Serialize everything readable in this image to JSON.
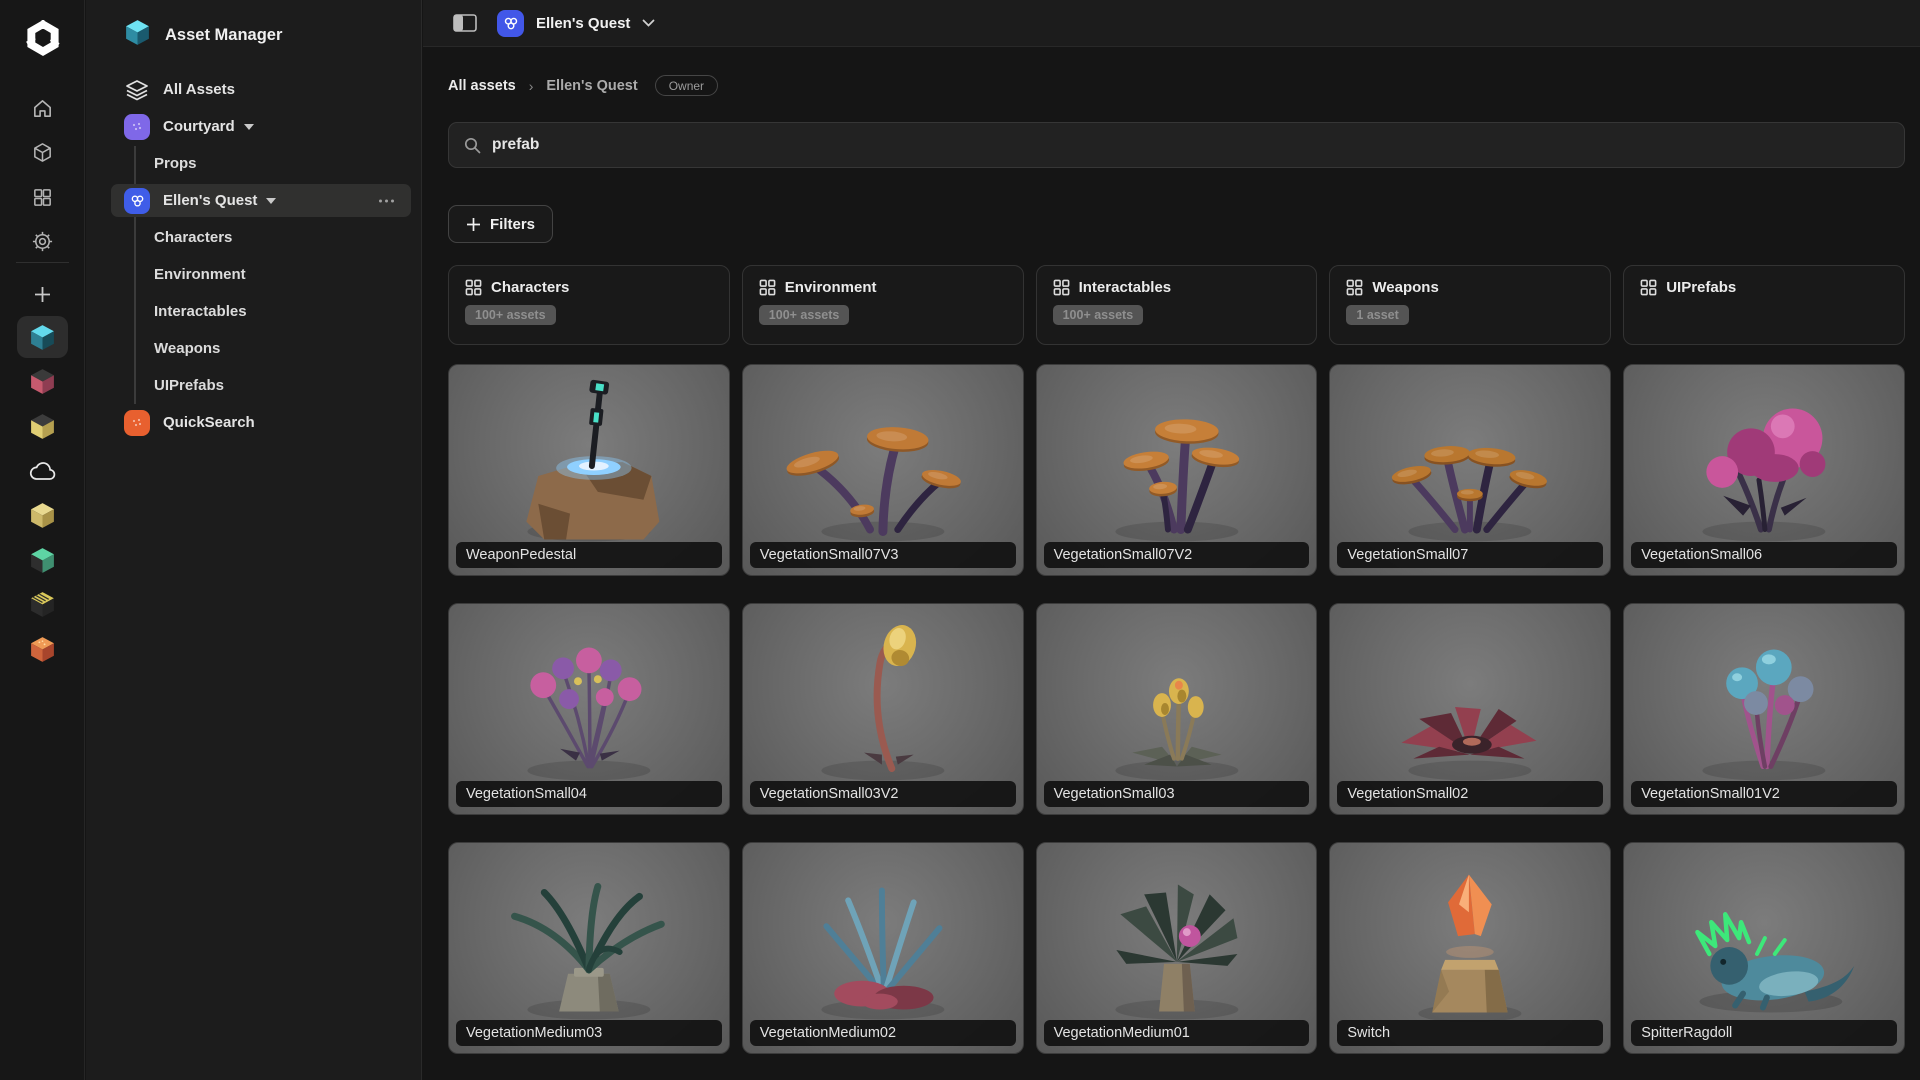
{
  "rail": {
    "logo": "unity-logo",
    "nav_icons": [
      {
        "name": "home-icon"
      },
      {
        "name": "box-icon"
      },
      {
        "name": "grid-icon"
      },
      {
        "name": "settings-gear-icon"
      }
    ],
    "projects": [
      {
        "name": "asset-manager-cube",
        "kind": "cube",
        "selected": true,
        "top": "#62d9ec",
        "left": "#2e7f93",
        "right": "#174b58"
      },
      {
        "name": "project-rose-cube",
        "kind": "cube",
        "top": "#3a3a3a",
        "left": "#c75a6e",
        "right": "#8f3d52"
      },
      {
        "name": "project-amber-cube",
        "kind": "cube",
        "top": "#3c3c3c",
        "left": "#e0ce74",
        "right": "#b5a050"
      },
      {
        "name": "cloud-icon",
        "kind": "cloud"
      },
      {
        "name": "project-cream-cube",
        "kind": "cube",
        "top": "#e8d98f",
        "left": "#cdb96a",
        "right": "#a89247"
      },
      {
        "name": "project-mint-cube",
        "kind": "cube",
        "top": "#5ed4a4",
        "left": "#2e2e2e",
        "right": "#3f8f70"
      },
      {
        "name": "project-striped-cube",
        "kind": "cube-striped",
        "top": "#d9c85a",
        "left": "#2c2c2c",
        "right": "#242424"
      },
      {
        "name": "project-ember-cube",
        "kind": "cube-dotted",
        "top": "#ef9a55",
        "left": "#d0653c",
        "right": "#a8452c"
      }
    ]
  },
  "sidebar": {
    "title": "Asset Manager",
    "title_icon_colors": {
      "top": "#6ee2f2",
      "left": "#2e8ca3",
      "right": "#1a5a6e"
    },
    "items": [
      {
        "label": "All Assets",
        "type": "root",
        "icon": "layers"
      },
      {
        "label": "Courtyard",
        "type": "root",
        "icon": "tile",
        "glyph": "dots",
        "color": "#7f68e8",
        "caret": true
      },
      {
        "label": "Props",
        "type": "sub"
      },
      {
        "label": "Ellen's Quest",
        "type": "root",
        "icon": "tile",
        "glyph": "circles",
        "color": "#3f5de8",
        "caret": true,
        "selected": true,
        "ellipsis": true
      },
      {
        "label": "Characters",
        "type": "sub"
      },
      {
        "label": "Environment",
        "type": "sub"
      },
      {
        "label": "Interactables",
        "type": "sub"
      },
      {
        "label": "Weapons",
        "type": "sub"
      },
      {
        "label": "UIPrefabs",
        "type": "sub"
      },
      {
        "label": "QuickSearch",
        "type": "root",
        "icon": "tile",
        "glyph": "dots",
        "color": "#e8602f"
      }
    ]
  },
  "topbar": {
    "project": "Ellen's Quest",
    "project_icon_color": "#4257e8"
  },
  "breadcrumb": {
    "root": "All assets",
    "separator": "›",
    "current": "Ellen's Quest",
    "badge": "Owner"
  },
  "search": {
    "value": "prefab"
  },
  "filters": {
    "label": "Filters"
  },
  "categories": [
    {
      "label": "Characters",
      "count": "100+ assets"
    },
    {
      "label": "Environment",
      "count": "100+ assets"
    },
    {
      "label": "Interactables",
      "count": "100+ assets"
    },
    {
      "label": "Weapons",
      "count": "1 asset"
    },
    {
      "label": "UIPrefabs",
      "count": ""
    }
  ],
  "assets": [
    {
      "name": "WeaponPedestal",
      "kind": "pedestal",
      "colors": {
        "c1": "#8d6a4a",
        "c2": "#6b4e34",
        "c3": "#8fd0ff",
        "c4": "#1b1d22",
        "c5": "#49e0c8"
      }
    },
    {
      "name": "VegetationSmall07V3",
      "kind": "mush3",
      "colors": {
        "c1": "#c07a36",
        "c2": "#8f5826",
        "c3": "#4c3a5e",
        "c4": "#2e2440"
      }
    },
    {
      "name": "VegetationSmall07V2",
      "kind": "mushCluster",
      "colors": {
        "c1": "#c67f38",
        "c2": "#925a26",
        "c3": "#4c3a5e",
        "c4": "#2e2440"
      }
    },
    {
      "name": "VegetationSmall07",
      "kind": "mushWide",
      "colors": {
        "c1": "#b9772f",
        "c2": "#875222",
        "c3": "#4c3a5e",
        "c4": "#2e2440"
      }
    },
    {
      "name": "VegetationSmall06",
      "kind": "flower",
      "colors": {
        "c1": "#c9569b",
        "c2": "#a03a78",
        "c3": "#3a3048",
        "c4": "#282134"
      }
    },
    {
      "name": "VegetationSmall04",
      "kind": "berries",
      "colors": {
        "c1": "#c75f9f",
        "c2": "#8a5aa8",
        "c3": "#5c4a6e",
        "c4": "#d8c05a"
      }
    },
    {
      "name": "VegetationSmall03V2",
      "kind": "stalk",
      "colors": {
        "c1": "#d9b44e",
        "c2": "#b08a32",
        "c3": "#9a5a50",
        "c4": "#4a3a40"
      }
    },
    {
      "name": "VegetationSmall03",
      "kind": "smallBulbs",
      "colors": {
        "c1": "#d9b44e",
        "c2": "#a8862f",
        "c3": "#8a7a58",
        "c4": "#5c6156"
      }
    },
    {
      "name": "VegetationSmall02",
      "kind": "succulent",
      "colors": {
        "c1": "#93404f",
        "c2": "#5e2a36",
        "c3": "#3a232a",
        "c4": "#b06a5a"
      }
    },
    {
      "name": "VegetationSmall01V2",
      "kind": "tealBulbs",
      "colors": {
        "c1": "#5ba7bf",
        "c2": "#7c8aa2",
        "c3": "#a1538c",
        "c4": "#6e3f63"
      }
    },
    {
      "name": "VegetationMedium03",
      "kind": "palm",
      "colors": {
        "c1": "#35544b",
        "c2": "#24403a",
        "c3": "#8d8a7c",
        "c4": "#6f6c60"
      }
    },
    {
      "name": "VegetationMedium02",
      "kind": "spiky",
      "colors": {
        "c1": "#4f7f97",
        "c2": "#6fa3b8",
        "c3": "#a34b5e",
        "c4": "#7c3847"
      }
    },
    {
      "name": "VegetationMedium01",
      "kind": "rosette",
      "colors": {
        "c1": "#3c4a42",
        "c2": "#2b3832",
        "c3": "#8f8066",
        "c4": "#c0559e"
      }
    },
    {
      "name": "Switch",
      "kind": "crystal",
      "colors": {
        "c1": "#e06a38",
        "c2": "#f08f52",
        "c3": "#a5885e",
        "c4": "#846c48"
      }
    },
    {
      "name": "SpitterRagdoll",
      "kind": "creature",
      "colors": {
        "c1": "#4e8a9c",
        "c2": "#35606f",
        "c3": "#3de87a",
        "c4": "#7ab0bd"
      }
    }
  ]
}
